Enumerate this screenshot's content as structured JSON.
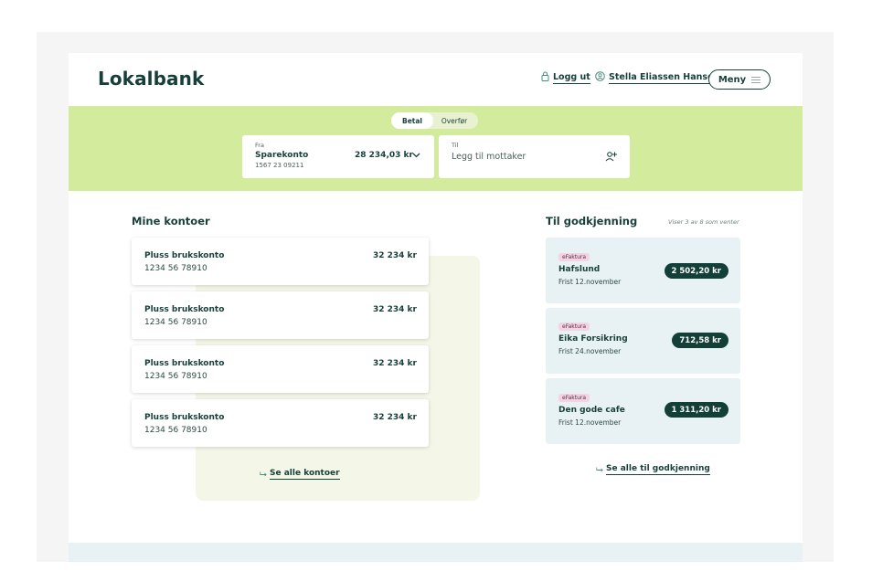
{
  "header": {
    "logo": "Lokalbank",
    "logout_label": "Logg ut",
    "user_name": "Stella Eliassen Hansen",
    "menu_label": "Meny"
  },
  "payment": {
    "tabs": [
      {
        "label": "Betal",
        "active": true
      },
      {
        "label": "Overfør",
        "active": false
      }
    ],
    "from": {
      "label": "Fra",
      "account_name": "Sparekonto",
      "account_number": "1567 23 09211",
      "balance": "28 234,03 kr"
    },
    "to": {
      "label": "Til",
      "placeholder": "Legg til mottaker"
    }
  },
  "accounts": {
    "title": "Mine kontoer",
    "items": [
      {
        "name": "Pluss brukskonto",
        "number": "1234 56 78910",
        "balance": "32 234 kr"
      },
      {
        "name": "Pluss brukskonto",
        "number": "1234 56 78910",
        "balance": "32 234 kr"
      },
      {
        "name": "Pluss brukskonto",
        "number": "1234 56 78910",
        "balance": "32 234 kr"
      },
      {
        "name": "Pluss brukskonto",
        "number": "1234 56 78910",
        "balance": "32 234 kr"
      }
    ],
    "see_all_label": "Se alle kontoer"
  },
  "approvals": {
    "title": "Til godkjenning",
    "note": "Viser 3 av 8 som venter",
    "items": [
      {
        "badge": "eFaktura",
        "name": "Hafslund",
        "due": "Frist 12.november",
        "amount": "2 502,20 kr"
      },
      {
        "badge": "eFaktura",
        "name": "Eika Forsikring",
        "due": "Frist 24.november",
        "amount": "712,58 kr"
      },
      {
        "badge": "eFaktura",
        "name": "Den gode cafe",
        "due": "Frist 12.november",
        "amount": "1 311,20 kr"
      }
    ],
    "see_all_label": "Se alle til godkjenning"
  },
  "colors": {
    "brand_dark": "#173f39",
    "band_green": "#d3eb9c",
    "bill_bg": "#e8f2f5",
    "badge_pink": "#f3d3e4"
  },
  "icons": {
    "logout": "lock-icon",
    "user": "user-circle-icon",
    "menu": "hamburger-icon",
    "from_dropdown": "chevron-down-icon",
    "add_recipient": "add-person-icon",
    "see_all": "arrow-right-icon"
  }
}
